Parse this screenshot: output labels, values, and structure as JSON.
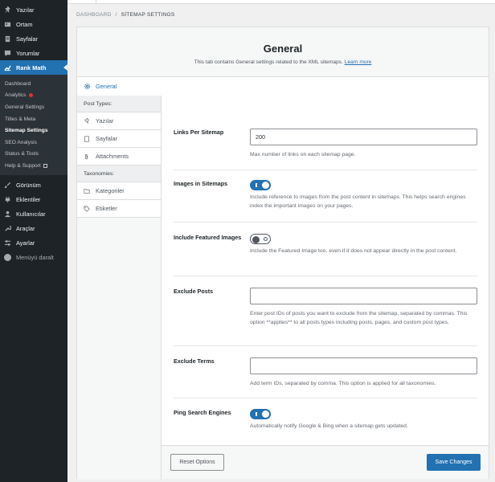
{
  "sidebar": {
    "items_top": [
      {
        "label": "Yazılar",
        "icon": "pin-icon"
      },
      {
        "label": "Ortam",
        "icon": "media-icon"
      },
      {
        "label": "Sayfalar",
        "icon": "page-icon"
      },
      {
        "label": "Yorumlar",
        "icon": "comment-icon"
      }
    ],
    "active": {
      "label": "Rank Math",
      "icon": "rank-math-icon"
    },
    "submenu": [
      "Dashboard",
      "Analytics",
      "General Settings",
      "Titles & Meta",
      "Sitemap Settings",
      "SEO Analysis",
      "Status & Tools",
      "Help & Support"
    ],
    "items_bottom": [
      {
        "label": "Görünüm",
        "icon": "brush-icon"
      },
      {
        "label": "Eklentiler",
        "icon": "plugin-icon"
      },
      {
        "label": "Kullanıcılar",
        "icon": "users-icon"
      },
      {
        "label": "Araçlar",
        "icon": "tools-icon"
      },
      {
        "label": "Ayarlar",
        "icon": "settings-icon"
      }
    ],
    "collapse_label": "Menüyü daralt"
  },
  "breadcrumb": {
    "parent": "DASHBOARD",
    "separator": "/",
    "current": "SİTEMAP SETTINGS"
  },
  "header": {
    "title": "General",
    "description": "This tab contains General settings related to the XML sitemaps.",
    "learn_more": "Learn more"
  },
  "nav": {
    "active": "General",
    "post_types_heading": "Post Types:",
    "post_types": [
      "Yazılar",
      "Sayfalar",
      "Attachments"
    ],
    "taxonomies_heading": "Taxonomies:",
    "taxonomies": [
      "Kategoriler",
      "Etiketler"
    ]
  },
  "settings": {
    "links_per_sitemap": {
      "label": "Links Per Sitemap",
      "value": "200",
      "desc": "Max number of links on each sitemap page."
    },
    "images_in_sitemaps": {
      "label": "Images in Sitemaps",
      "enabled": true,
      "desc": "Include reference to images from the post content in sitemaps. This helps search engines index the important images on your pages."
    },
    "include_featured_images": {
      "label": "Include Featured Images",
      "enabled": false,
      "desc": "Include the Featured Image too, even if it does not appear directly in the post content."
    },
    "exclude_posts": {
      "label": "Exclude Posts",
      "value": "",
      "desc": "Enter post IDs of posts you want to exclude from the sitemap, separated by commas. This option **applies** to all posts types including posts, pages, and custom post types."
    },
    "exclude_terms": {
      "label": "Exclude Terms",
      "value": "",
      "desc": "Add term IDs, separated by comma. This option is applied for all taxonomies."
    },
    "ping_search_engines": {
      "label": "Ping Search Engines",
      "enabled": true,
      "desc": "Automatically notify Google & Bing when a sitemap gets updated."
    }
  },
  "footer": {
    "reset_label": "Reset Options",
    "save_label": "Save Changes"
  },
  "colors": {
    "accent": "#2271b1",
    "sidebar_bg": "#1d2327",
    "submenu_bg": "#2c3338",
    "notification_dot": "#d63638"
  }
}
